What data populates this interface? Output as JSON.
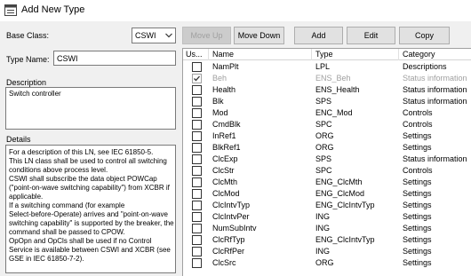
{
  "window": {
    "title": "Add New Type"
  },
  "left": {
    "base_class_label": "Base Class:",
    "base_class_value": "CSWI",
    "type_name_label": "Type Name:",
    "type_name_value": "CSWI",
    "description_label": "Description",
    "description_text": "Switch controller",
    "details_label": "Details",
    "details_lines": [
      "For a description of this LN, see IEC 61850-5.",
      "This LN class shall be used to control all switching",
      "conditions above process level.",
      "CSWI shall subscribe the data object POWCap",
      "(\"point-on-wave switching capability\") from XCBR if",
      "applicable.",
      "If a switching command (for example",
      "Select-before-Operate) arrives and \"point-on-wave",
      "switching capability\" is supported by the breaker, the",
      "command shall be passed to CPOW.",
      "OpOpn and OpCls shall be used if no Control",
      "Service is available between CSWI and XCBR (see",
      "GSE in IEC 61850-7-2)."
    ]
  },
  "toolbar": {
    "move_up": "Move Up",
    "move_down": "Move Down",
    "add": "Add",
    "edit": "Edit",
    "copy": "Copy"
  },
  "grid": {
    "headers": [
      "Us...",
      "Name",
      "Type",
      "Category"
    ],
    "rows": [
      {
        "checked": false,
        "dim": false,
        "name": "NamPlt",
        "type": "LPL",
        "category": "Descriptions"
      },
      {
        "checked": true,
        "dim": true,
        "name": "Beh",
        "type": "ENS_Beh",
        "category": "Status information"
      },
      {
        "checked": false,
        "dim": false,
        "name": "Health",
        "type": "ENS_Health",
        "category": "Status information"
      },
      {
        "checked": false,
        "dim": false,
        "name": "Blk",
        "type": "SPS",
        "category": "Status information"
      },
      {
        "checked": false,
        "dim": false,
        "name": "Mod",
        "type": "ENC_Mod",
        "category": "Controls"
      },
      {
        "checked": false,
        "dim": false,
        "name": "CmdBlk",
        "type": "SPC",
        "category": "Controls"
      },
      {
        "checked": false,
        "dim": false,
        "name": "InRef1",
        "type": "ORG",
        "category": "Settings"
      },
      {
        "checked": false,
        "dim": false,
        "name": "BlkRef1",
        "type": "ORG",
        "category": "Settings"
      },
      {
        "checked": false,
        "dim": false,
        "name": "ClcExp",
        "type": "SPS",
        "category": "Status information"
      },
      {
        "checked": false,
        "dim": false,
        "name": "ClcStr",
        "type": "SPC",
        "category": "Controls"
      },
      {
        "checked": false,
        "dim": false,
        "name": "ClcMth",
        "type": "ENG_ClcMth",
        "category": "Settings"
      },
      {
        "checked": false,
        "dim": false,
        "name": "ClcMod",
        "type": "ENG_ClcMod",
        "category": "Settings"
      },
      {
        "checked": false,
        "dim": false,
        "name": "ClcIntvTyp",
        "type": "ENG_ClcIntvTyp",
        "category": "Settings"
      },
      {
        "checked": false,
        "dim": false,
        "name": "ClcIntvPer",
        "type": "ING",
        "category": "Settings"
      },
      {
        "checked": false,
        "dim": false,
        "name": "NumSubIntv",
        "type": "ING",
        "category": "Settings"
      },
      {
        "checked": false,
        "dim": false,
        "name": "ClcRfTyp",
        "type": "ENG_ClcIntvTyp",
        "category": "Settings"
      },
      {
        "checked": false,
        "dim": false,
        "name": "ClcRfPer",
        "type": "ING",
        "category": "Settings"
      },
      {
        "checked": false,
        "dim": false,
        "name": "ClcSrc",
        "type": "ORG",
        "category": "Settings"
      }
    ]
  }
}
